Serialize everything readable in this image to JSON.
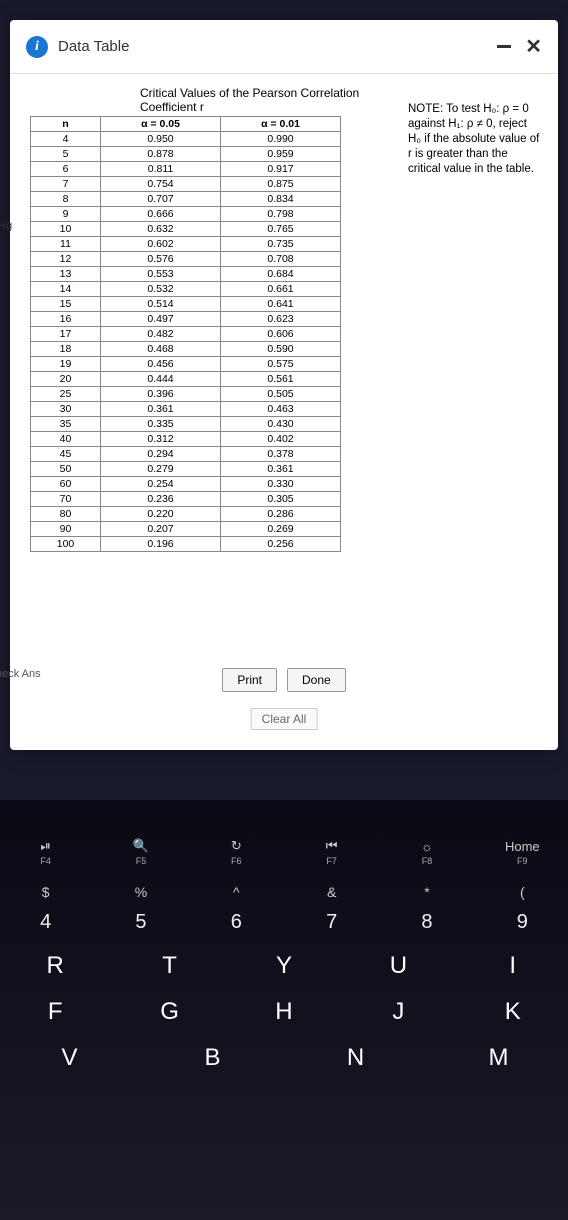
{
  "window": {
    "title": "Data Table",
    "info_glyph": "i",
    "minimize": "—",
    "close": "✕"
  },
  "left_partial": "Hg",
  "check_ans": "heck Ans",
  "chart_data": {
    "type": "table",
    "title": "Critical Values of the Pearson Correlation Coefficient r",
    "columns": [
      "n",
      "α = 0.05",
      "α = 0.01"
    ],
    "rows": [
      {
        "n": "4",
        "a05": "0.950",
        "a01": "0.990"
      },
      {
        "n": "5",
        "a05": "0.878",
        "a01": "0.959"
      },
      {
        "n": "6",
        "a05": "0.811",
        "a01": "0.917"
      },
      {
        "n": "7",
        "a05": "0.754",
        "a01": "0.875"
      },
      {
        "n": "8",
        "a05": "0.707",
        "a01": "0.834"
      },
      {
        "n": "9",
        "a05": "0.666",
        "a01": "0.798"
      },
      {
        "n": "10",
        "a05": "0.632",
        "a01": "0.765"
      },
      {
        "n": "11",
        "a05": "0.602",
        "a01": "0.735"
      },
      {
        "n": "12",
        "a05": "0.576",
        "a01": "0.708"
      },
      {
        "n": "13",
        "a05": "0.553",
        "a01": "0.684"
      },
      {
        "n": "14",
        "a05": "0.532",
        "a01": "0.661"
      },
      {
        "n": "15",
        "a05": "0.514",
        "a01": "0.641"
      },
      {
        "n": "16",
        "a05": "0.497",
        "a01": "0.623"
      },
      {
        "n": "17",
        "a05": "0.482",
        "a01": "0.606"
      },
      {
        "n": "18",
        "a05": "0.468",
        "a01": "0.590"
      },
      {
        "n": "19",
        "a05": "0.456",
        "a01": "0.575"
      },
      {
        "n": "20",
        "a05": "0.444",
        "a01": "0.561"
      },
      {
        "n": "25",
        "a05": "0.396",
        "a01": "0.505"
      },
      {
        "n": "30",
        "a05": "0.361",
        "a01": "0.463"
      },
      {
        "n": "35",
        "a05": "0.335",
        "a01": "0.430"
      },
      {
        "n": "40",
        "a05": "0.312",
        "a01": "0.402"
      },
      {
        "n": "45",
        "a05": "0.294",
        "a01": "0.378"
      },
      {
        "n": "50",
        "a05": "0.279",
        "a01": "0.361"
      },
      {
        "n": "60",
        "a05": "0.254",
        "a01": "0.330"
      },
      {
        "n": "70",
        "a05": "0.236",
        "a01": "0.305"
      },
      {
        "n": "80",
        "a05": "0.220",
        "a01": "0.286"
      },
      {
        "n": "90",
        "a05": "0.207",
        "a01": "0.269"
      },
      {
        "n": "100",
        "a05": "0.196",
        "a01": "0.256"
      }
    ],
    "note": "NOTE: To test H₀: ρ = 0 against H₁: ρ ≠ 0, reject H₀ if the absolute value of r is greater than the critical value in the table."
  },
  "buttons": {
    "print": "Print",
    "done": "Done",
    "clear_all": "Clear All"
  },
  "keyboard": {
    "frow": [
      {
        "sym": "⏯",
        "lbl": "F4"
      },
      {
        "sym": "🔍",
        "lbl": "F5"
      },
      {
        "sym": "↻",
        "lbl": "F6"
      },
      {
        "sym": "⏮",
        "lbl": "F7"
      },
      {
        "sym": "☼",
        "lbl": "F8"
      },
      {
        "sym": "Home",
        "lbl": "F9"
      }
    ],
    "numrow": [
      {
        "u": "$",
        "l": "4"
      },
      {
        "u": "%",
        "l": "5"
      },
      {
        "u": "^",
        "l": "6"
      },
      {
        "u": "&",
        "l": "7"
      },
      {
        "u": "*",
        "l": "8"
      },
      {
        "u": "(",
        "l": "9"
      }
    ],
    "row1": [
      "R",
      "T",
      "Y",
      "U",
      "I"
    ],
    "row2": [
      "F",
      "G",
      "H",
      "J",
      "K"
    ],
    "row3": [
      "V",
      "B",
      "N",
      "M"
    ]
  }
}
